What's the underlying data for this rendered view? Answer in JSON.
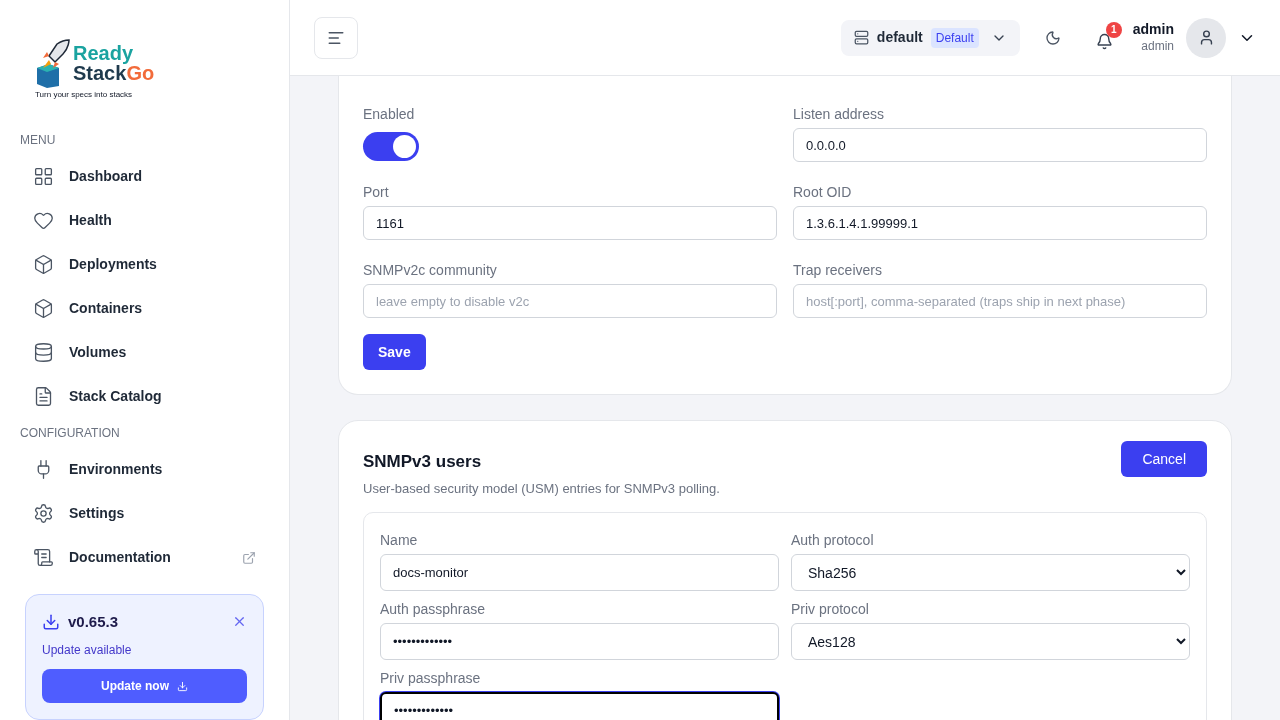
{
  "logo": {
    "word1": "Ready",
    "word2": "Stack",
    "word3": "Go",
    "tagline": "Turn your specs into stacks"
  },
  "sidebar": {
    "sections": [
      {
        "title": "MENU",
        "items": [
          {
            "label": "Dashboard",
            "external": false
          },
          {
            "label": "Health",
            "external": false
          },
          {
            "label": "Deployments",
            "external": false
          },
          {
            "label": "Containers",
            "external": false
          },
          {
            "label": "Volumes",
            "external": false
          },
          {
            "label": "Stack Catalog",
            "external": false
          }
        ]
      },
      {
        "title": "CONFIGURATION",
        "items": [
          {
            "label": "Environments",
            "external": false
          },
          {
            "label": "Settings",
            "external": false
          },
          {
            "label": "Documentation",
            "external": true
          }
        ]
      }
    ],
    "update": {
      "version": "v0.65.3",
      "message": "Update available",
      "button": "Update now"
    }
  },
  "header": {
    "environment": "default",
    "environment_badge": "Default",
    "notifications": "1",
    "user_name": "admin",
    "user_role": "admin"
  },
  "agent_card": {
    "fields": [
      {
        "kind": "toggle",
        "label": "Enabled",
        "on": true
      },
      {
        "kind": "input",
        "label": "Listen address",
        "value": "0.0.0.0"
      },
      {
        "kind": "input",
        "label": "Port",
        "value": "1161"
      },
      {
        "kind": "input",
        "label": "Root OID",
        "value": "1.3.6.1.4.1.99999.1"
      },
      {
        "kind": "input",
        "label": "SNMPv2c community",
        "placeholder": "leave empty to disable v2c"
      },
      {
        "kind": "input",
        "label": "Trap receivers",
        "placeholder": "host[:port], comma-separated (traps ship in next phase)"
      }
    ],
    "save_button": "Save"
  },
  "users_card": {
    "title": "SNMPv3 users",
    "subtitle": "User-based security model (USM) entries for SNMPv3 polling.",
    "cancel_button": "Cancel",
    "fields": [
      {
        "kind": "input",
        "label": "Name",
        "value": "docs-monitor",
        "focused": false
      },
      {
        "kind": "select",
        "label": "Auth protocol",
        "value": "Sha256"
      },
      {
        "kind": "input",
        "label": "Auth passphrase",
        "value": "•••••••••••••",
        "focused": false
      },
      {
        "kind": "select",
        "label": "Priv protocol",
        "value": "Aes128"
      },
      {
        "kind": "input",
        "label": "Priv passphrase",
        "value": "•••••••••••••",
        "focused": true
      }
    ]
  }
}
